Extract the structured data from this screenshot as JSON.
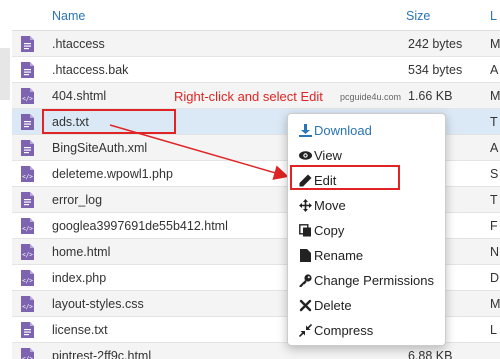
{
  "header": {
    "name": "Name",
    "size": "Size",
    "type_partial": "L"
  },
  "files": [
    {
      "name": ".htaccess",
      "size": "242 bytes",
      "type": "M",
      "icon": "text-file-icon"
    },
    {
      "name": ".htaccess.bak",
      "size": "534 bytes",
      "type": "A",
      "icon": "text-file-icon"
    },
    {
      "name": "404.shtml",
      "size": "1.66 KB",
      "type": "M",
      "icon": "code-file-icon"
    },
    {
      "name": "ads.txt",
      "size": "s",
      "type": "T",
      "icon": "text-file-icon"
    },
    {
      "name": "BingSiteAuth.xml",
      "size": "",
      "type": "A",
      "icon": "text-file-icon"
    },
    {
      "name": "deleteme.wpowl1.php",
      "size": "",
      "type": "S",
      "icon": "code-file-icon"
    },
    {
      "name": "error_log",
      "size": "5 KB",
      "type": "T",
      "icon": "text-file-icon"
    },
    {
      "name": "googlea3997691de55b412.html",
      "size": "s",
      "type": "F",
      "icon": "code-file-icon"
    },
    {
      "name": "home.html",
      "size": "",
      "type": "N",
      "icon": "code-file-icon"
    },
    {
      "name": "index.php",
      "size": "es",
      "type": "D",
      "icon": "code-file-icon"
    },
    {
      "name": "layout-styles.css",
      "size": "",
      "type": "M",
      "icon": "code-file-icon"
    },
    {
      "name": "license.txt",
      "size": "B",
      "type": "L",
      "icon": "text-file-icon"
    },
    {
      "name": "pintrest-2ff9c.html",
      "size": "6.88 KB",
      "type": "",
      "icon": "code-file-icon"
    }
  ],
  "annotation": {
    "instruction": "Right-click and select Edit",
    "watermark": "pcguide4u.com"
  },
  "context_menu": {
    "items": [
      {
        "label": "Download",
        "icon": "download-icon"
      },
      {
        "label": "View",
        "icon": "eye-icon"
      },
      {
        "label": "Edit",
        "icon": "pencil-icon"
      },
      {
        "label": "Move",
        "icon": "move-arrows-icon"
      },
      {
        "label": "Copy",
        "icon": "copy-icon"
      },
      {
        "label": "Rename",
        "icon": "rename-file-icon"
      },
      {
        "label": "Change Permissions",
        "icon": "key-icon"
      },
      {
        "label": "Delete",
        "icon": "x-icon"
      },
      {
        "label": "Compress",
        "icon": "compress-icon"
      }
    ]
  },
  "colors": {
    "link_blue": "#2a74b8",
    "annotation_red": "#e02424",
    "icon_purple": "#7e64b0",
    "selected_row": "#dbe9f6"
  }
}
